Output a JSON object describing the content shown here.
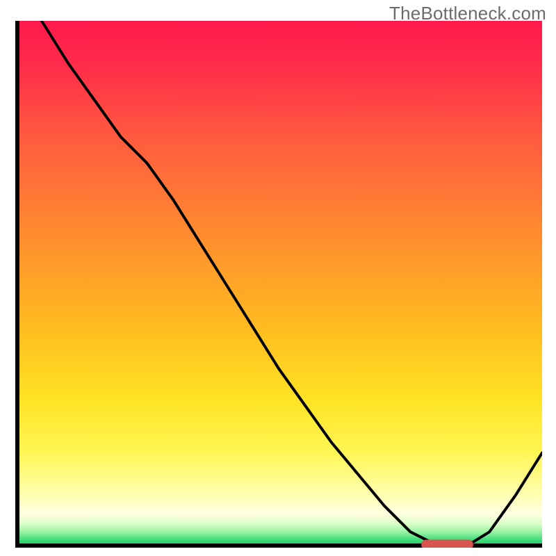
{
  "watermark": "TheBottleneck.com",
  "colors": {
    "gradient_top": "#ff1a4b",
    "gradient_mid": "#ffe324",
    "gradient_bottom": "#17c45b",
    "curve": "#000000",
    "marker": "#d9534f",
    "axes": "#000000"
  },
  "chart_data": {
    "type": "line",
    "title": "",
    "xlabel": "",
    "ylabel": "",
    "xlim": [
      0,
      100
    ],
    "ylim": [
      0,
      100
    ],
    "x": [
      5,
      10,
      15,
      20,
      25,
      30,
      35,
      40,
      45,
      50,
      55,
      60,
      65,
      70,
      75,
      80,
      83,
      86,
      90,
      95,
      100
    ],
    "values": [
      100,
      92,
      85,
      78,
      73,
      66,
      58,
      50,
      42,
      34,
      27,
      20,
      14,
      8,
      3,
      0.5,
      0.5,
      0.5,
      3,
      10,
      18
    ],
    "marker_range_x": [
      78,
      86
    ],
    "marker_y": 0.6
  }
}
